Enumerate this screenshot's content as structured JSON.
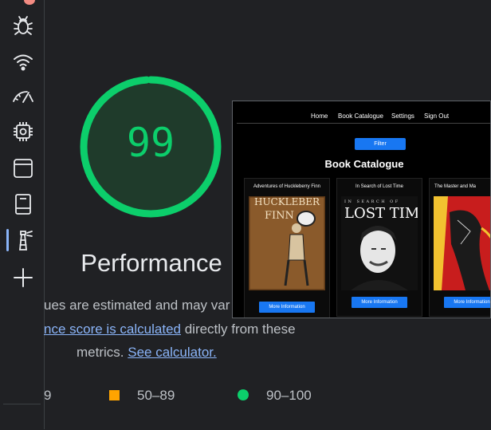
{
  "sidebar": {
    "items": [
      {
        "icon": "bug-icon"
      },
      {
        "icon": "wifi-icon"
      },
      {
        "icon": "speedometer-icon"
      },
      {
        "icon": "chip-icon"
      },
      {
        "icon": "window-icon"
      },
      {
        "icon": "storage-icon"
      },
      {
        "icon": "lighthouse-icon",
        "active": true
      },
      {
        "icon": "plus-icon"
      }
    ]
  },
  "report": {
    "score": "99",
    "score_fraction": 0.99,
    "category": "Performance",
    "desc_line1": "ues are estimated and may var",
    "desc_link": "nce score is calculated",
    "desc_line2_rest": " directly from these",
    "desc_line3_prefix": "metrics. ",
    "desc_calc_link": "See calculator.",
    "legend": {
      "fail": "9",
      "average": "50–89",
      "pass": "90–100"
    },
    "colors": {
      "pass": "#0cce6b",
      "average": "#ffa400",
      "link": "#8ab4f8"
    }
  },
  "screenshot": {
    "nav": [
      "Home",
      "Book Catalogue",
      "Settings",
      "Sign Out"
    ],
    "filter_label": "Filter",
    "heading": "Book Catalogue",
    "books": [
      {
        "title": "Adventures of Huckleberry Finn",
        "cover_text": "HUCKLEBERRY FINN",
        "button": "More Information"
      },
      {
        "title": "In Search of Lost Time",
        "cover_text": "LOST TIM",
        "cover_subtext": "IN SEARCH OF",
        "button": "More Information"
      },
      {
        "title": "The Master and Ma",
        "button": "More Information"
      }
    ]
  }
}
